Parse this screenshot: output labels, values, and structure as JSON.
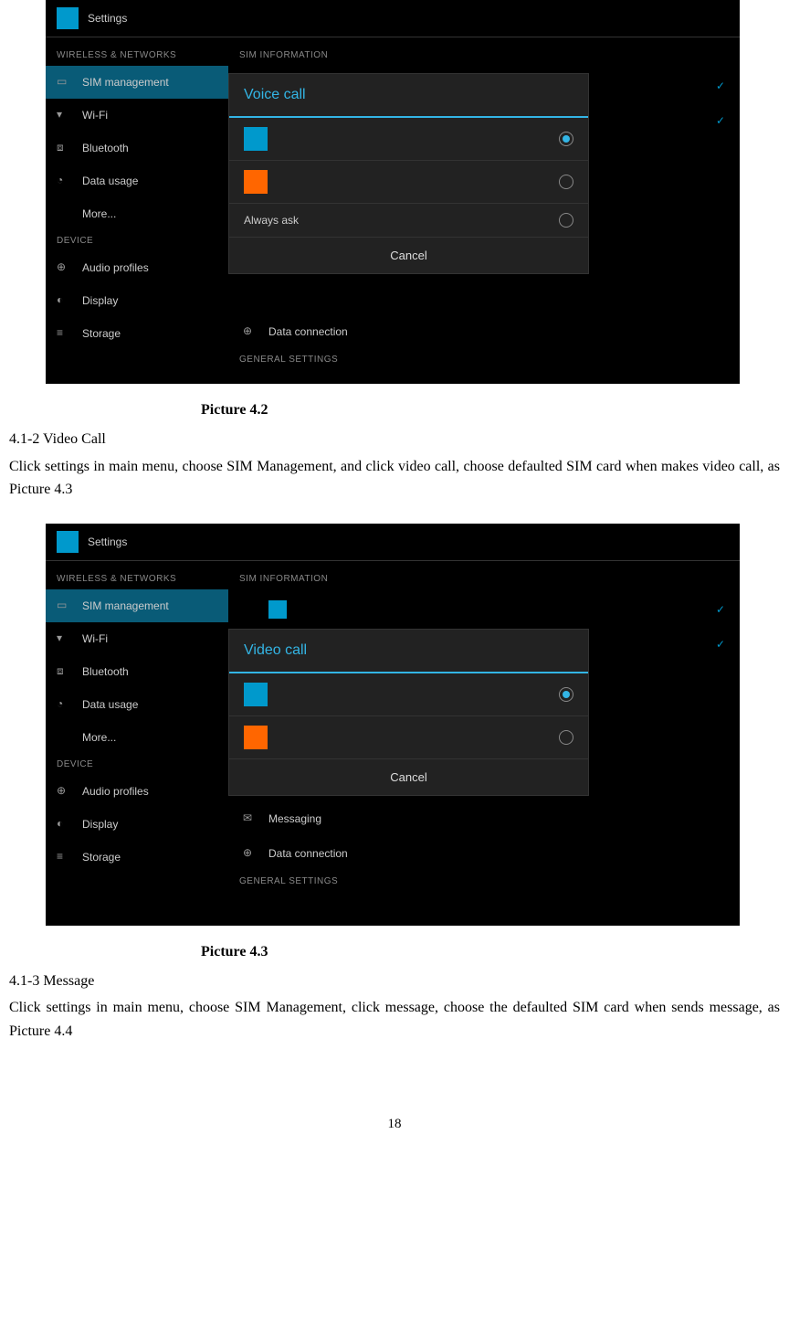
{
  "screenshot1": {
    "header_title": "Settings",
    "left": {
      "section1": "WIRELESS & NETWORKS",
      "items1": [
        "SIM management",
        "Wi-Fi",
        "Bluetooth",
        "Data usage",
        "More..."
      ],
      "section2": "DEVICE",
      "items2": [
        "Audio profiles",
        "Display",
        "Storage"
      ]
    },
    "right": {
      "section1": "SIM INFORMATION",
      "data_connection": "Data connection",
      "section2": "GENERAL SETTINGS"
    },
    "dialog": {
      "title": "Voice call",
      "always_ask": "Always ask",
      "cancel": "Cancel"
    }
  },
  "caption1": "Picture 4.2",
  "section1_heading": "4.1-2 Video Call",
  "section1_body": "Click settings in main menu, choose SIM Management, and click video call, choose defaulted SIM card when makes video call, as Picture 4.3",
  "screenshot2": {
    "header_title": "Settings",
    "left": {
      "section1": "WIRELESS & NETWORKS",
      "items1": [
        "SIM management",
        "Wi-Fi",
        "Bluetooth",
        "Data usage",
        "More..."
      ],
      "section2": "DEVICE",
      "items2": [
        "Audio profiles",
        "Display",
        "Storage"
      ]
    },
    "right": {
      "section1": "SIM INFORMATION",
      "messaging": "Messaging",
      "data_connection": "Data connection",
      "section2": "GENERAL SETTINGS"
    },
    "dialog": {
      "title": "Video call",
      "cancel": "Cancel"
    }
  },
  "caption2": "Picture 4.3",
  "section2_heading": "4.1-3 Message",
  "section2_body": "Click settings in main menu, choose SIM Management, click message, choose the defaulted SIM card when sends message, as Picture 4.4",
  "page_number": "18"
}
